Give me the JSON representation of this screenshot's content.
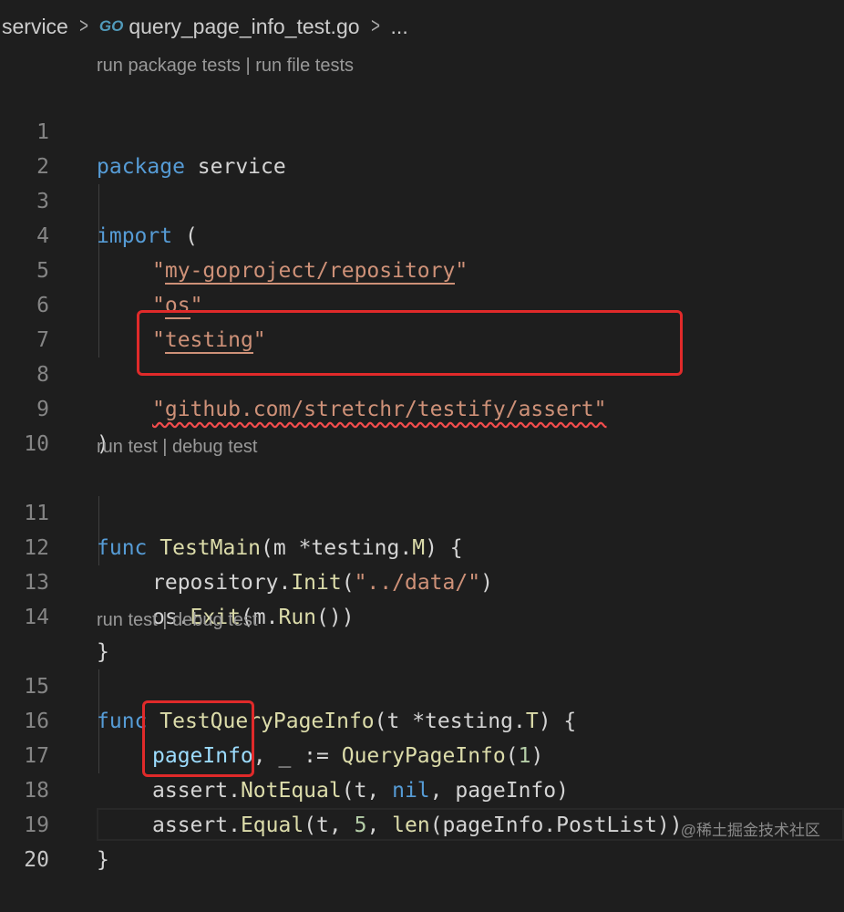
{
  "breadcrumb": {
    "folder": "service",
    "file_icon": "GO",
    "file": "query_page_info_test.go",
    "more": "..."
  },
  "codelens": {
    "run_package_tests": "run package tests",
    "run_file_tests": "run file tests",
    "run_test": "run test",
    "debug_test": "debug test",
    "separator": "|"
  },
  "lines": {
    "l1": {
      "n": "1",
      "kw": "package",
      "name": "service"
    },
    "l2": {
      "n": "2"
    },
    "l3": {
      "n": "3",
      "kw": "import",
      "paren": "("
    },
    "l4": {
      "n": "4",
      "q1": "\"",
      "text": "my-goproject/repository",
      "q2": "\""
    },
    "l5": {
      "n": "5",
      "q1": "\"",
      "text": "os",
      "q2": "\""
    },
    "l6": {
      "n": "6",
      "q1": "\"",
      "text": "testing",
      "q2": "\""
    },
    "l7": {
      "n": "7"
    },
    "l8": {
      "n": "8",
      "text": "\"github.com/stretchr/testify/assert\""
    },
    "l9": {
      "n": "9",
      "text": ")"
    },
    "l10": {
      "n": "10"
    },
    "l11": {
      "n": "11",
      "kw": "func",
      "fn": "TestMain",
      "p1": "(m *testing.",
      "t": "M",
      "p2": ") {"
    },
    "l12": {
      "n": "12",
      "pkg": "repository.",
      "fn": "Init",
      "p1": "(",
      "str": "\"../data/\"",
      "p2": ")"
    },
    "l13": {
      "n": "13",
      "pkg": "os.",
      "fn": "Exit",
      "p1": "(m.",
      "fn2": "Run",
      "p2": "())"
    },
    "l14": {
      "n": "14",
      "text": "}"
    },
    "l15": {
      "n": "15",
      "kw": "func",
      "fn": "TestQueryPageInfo",
      "p1": "(t *testing.",
      "t": "T",
      "p2": ") {"
    },
    "l16": {
      "n": "16",
      "var": "pageInfo",
      "p1": ", _ := ",
      "fn": "QueryPageInfo",
      "p2": "(",
      "num": "1",
      "p3": ")"
    },
    "l17": {
      "n": "17",
      "pkg": "assert.",
      "fn": "NotEqual",
      "p1": "(t, ",
      "kw": "nil",
      "p2": ", pageInfo)"
    },
    "l18": {
      "n": "18",
      "pkg": "assert.",
      "fn": "Equal",
      "p1": "(t, ",
      "num": "5",
      "p2": ", ",
      "fn2": "len",
      "p3": "(pageInfo.PostList))"
    },
    "l19": {
      "n": "19",
      "text": "}"
    },
    "l20": {
      "n": "20"
    }
  },
  "watermark": "@稀土掘金技术社区",
  "colors": {
    "background": "#1e1e1e",
    "keyword": "#569cd6",
    "string": "#ce9178",
    "function": "#dcdcaa",
    "highlight_box": "#e02a2a"
  }
}
